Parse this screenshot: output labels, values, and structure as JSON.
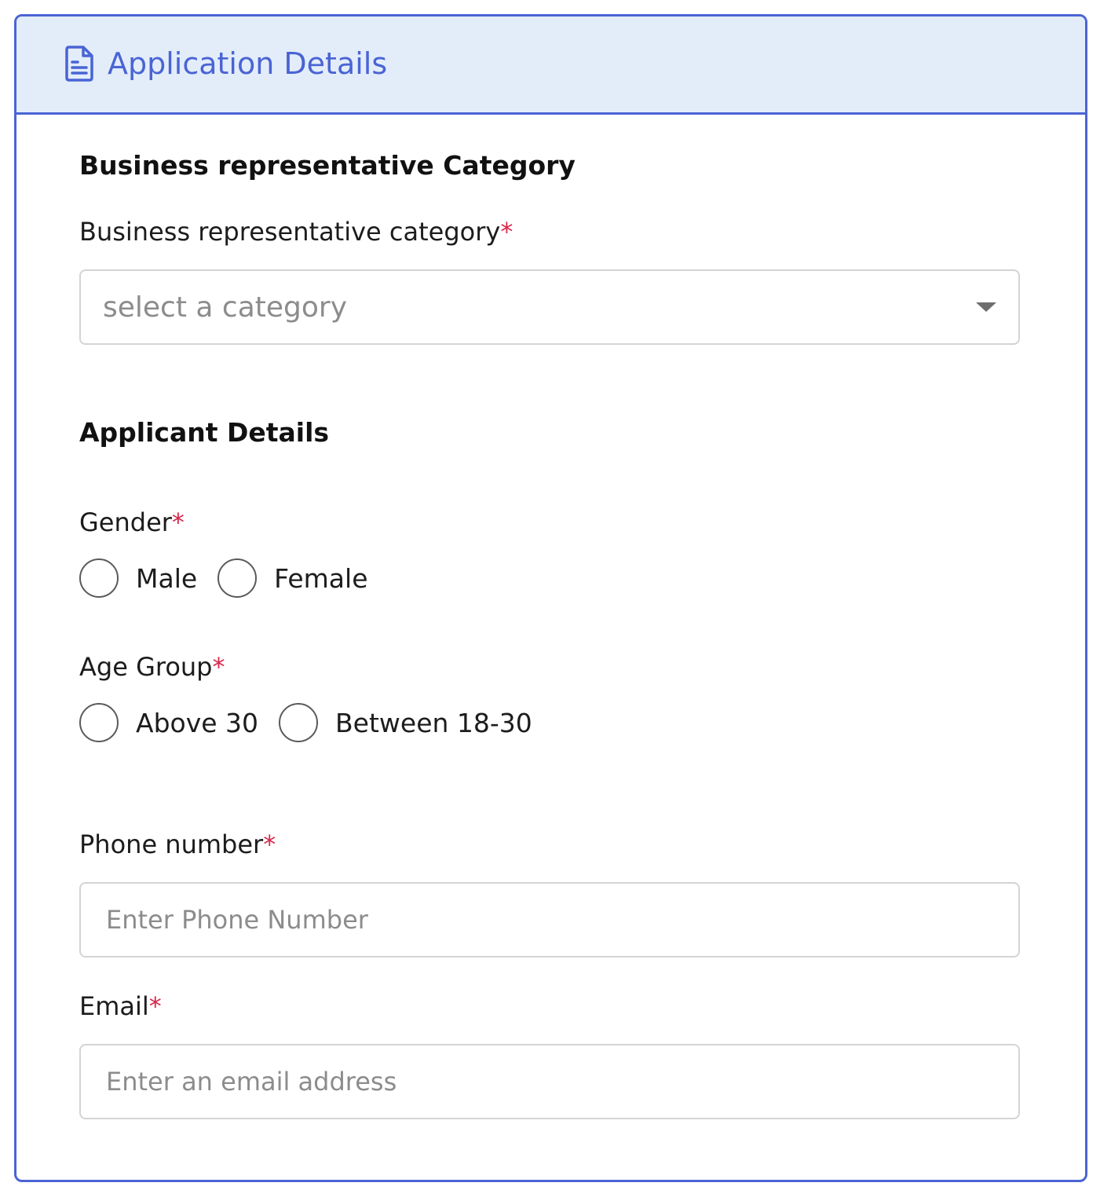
{
  "header": {
    "title": "Application Details",
    "icon": "document-icon",
    "accent_color": "#4a64d4",
    "background_color": "#e3edfa"
  },
  "category_section": {
    "title": "Business representative Category",
    "field_label": "Business representative category",
    "required_mark": "*",
    "select_placeholder": "select a category"
  },
  "applicant_section": {
    "title": "Applicant Details",
    "gender": {
      "label": "Gender",
      "required_mark": "*",
      "options": [
        "Male",
        "Female"
      ]
    },
    "age_group": {
      "label": "Age Group",
      "required_mark": "*",
      "options": [
        "Above 30",
        "Between 18-30"
      ]
    },
    "phone": {
      "label": "Phone number",
      "required_mark": "*",
      "placeholder": "Enter Phone Number"
    },
    "email": {
      "label": "Email",
      "required_mark": "*",
      "placeholder": "Enter an email address"
    }
  },
  "required_color": "#d8264a"
}
